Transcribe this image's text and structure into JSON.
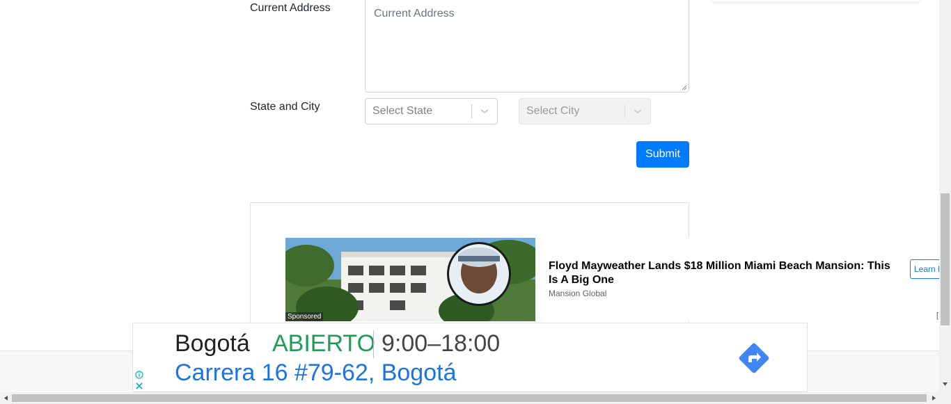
{
  "form": {
    "address_label": "Current Address",
    "address_placeholder": "Current Address",
    "state_city_label": "State and City",
    "state_placeholder": "Select State",
    "city_placeholder": "Select City",
    "submit_label": "Submit"
  },
  "native_ad": {
    "sponsored_label": "Sponsored",
    "headline": "Floyd Mayweather Lands $18 Million Miami Beach Mansion: This Is A Big One",
    "source": "Mansion Global",
    "cta_label": "Learn More",
    "bracket": "[",
    "cta_color": "#1a73e8"
  },
  "map_ad": {
    "city": "Bogotá",
    "status": "ABIERTO",
    "hours": "9:00–18:00",
    "address": "Carrera 16 #79-62, Bogotá",
    "status_color": "#1e9c56",
    "address_color": "#1a73e8",
    "directions_icon": "directions-icon",
    "info_icon": "info-icon",
    "close_icon": "close-icon"
  },
  "theme": {
    "primary": "#007bff"
  }
}
